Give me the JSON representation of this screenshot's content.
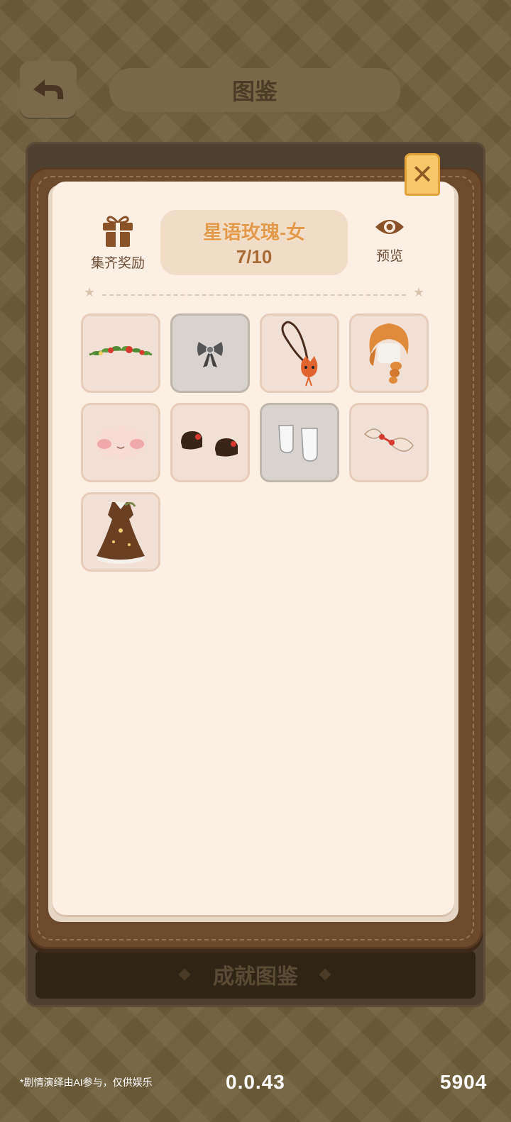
{
  "background": {
    "title": "图鉴",
    "bottom_button": "成就图鉴"
  },
  "modal": {
    "reward_label": "集齐奖励",
    "set_name": "星语玫瑰-女",
    "set_progress": "7/10",
    "preview_label": "预览",
    "close_icon": "close-icon",
    "items": [
      {
        "icon": "rose-garland-icon",
        "collected": true
      },
      {
        "icon": "bow-icon",
        "collected": false
      },
      {
        "icon": "fox-necklace-icon",
        "collected": true
      },
      {
        "icon": "braided-hair-icon",
        "collected": true
      },
      {
        "icon": "blush-face-icon",
        "collected": true
      },
      {
        "icon": "shoes-icon",
        "collected": true
      },
      {
        "icon": "socks-icon",
        "collected": false
      },
      {
        "icon": "hair-bows-icon",
        "collected": true
      },
      {
        "icon": "dress-icon",
        "collected": true
      }
    ]
  },
  "footer": {
    "note": "*剧情演绎由AI参与，仅供娱乐",
    "version": "0.0.43",
    "number": "5904"
  },
  "colors": {
    "accent": "#e39a4b",
    "book": "#6e4a2c",
    "page": "#fcefe3",
    "close": "#f7c86a"
  }
}
